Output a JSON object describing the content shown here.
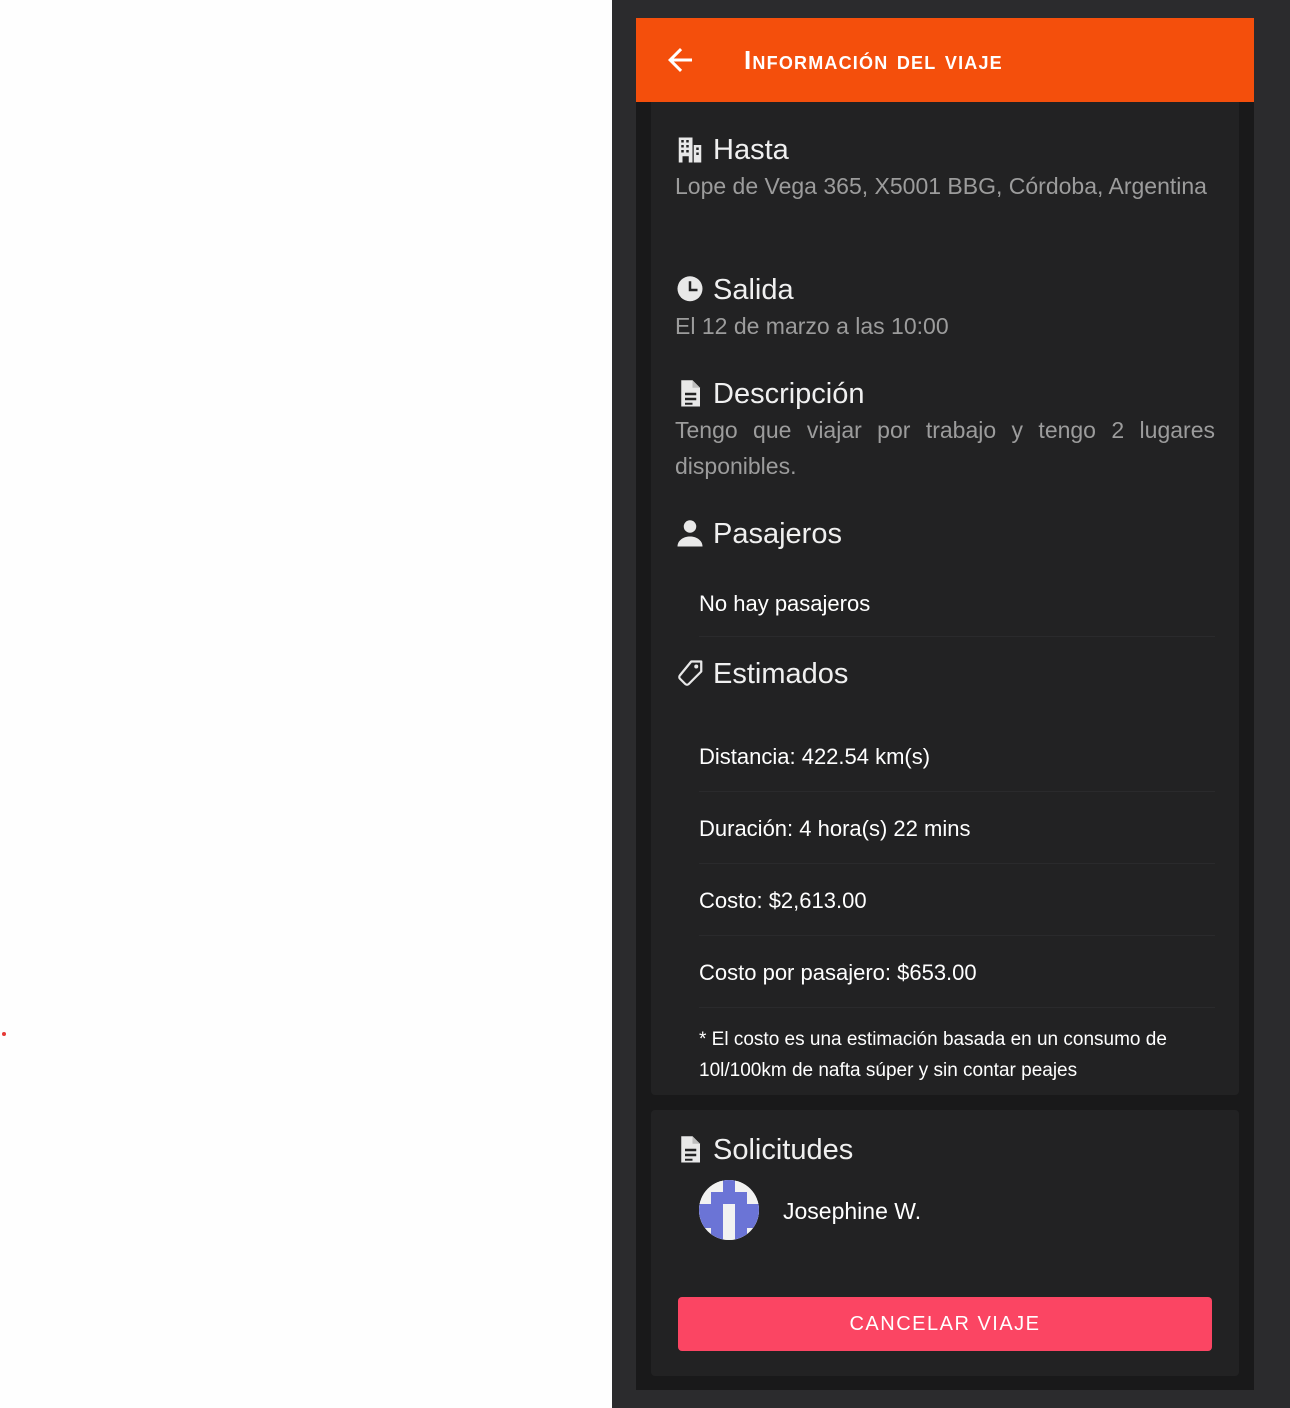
{
  "toolbar": {
    "title": "Información del viaje",
    "back_icon": "arrow-left-icon",
    "background": "#f44f0c"
  },
  "sections": {
    "hasta": {
      "icon": "building-icon",
      "title": "Hasta",
      "value": "Lope de Vega 365, X5001 BBG, Córdoba, Argentina"
    },
    "salida": {
      "icon": "clock-icon",
      "title": "Salida",
      "value": "El 12 de marzo a las 10:00"
    },
    "descripcion": {
      "icon": "document-icon",
      "title": "Descripción",
      "value": "Tengo que viajar por trabajo y tengo 2 lugares disponibles."
    },
    "pasajeros": {
      "icon": "person-icon",
      "title": "Pasajeros",
      "empty_text": "No hay pasajeros"
    },
    "estimados": {
      "icon": "tag-icon",
      "title": "Estimados",
      "items": [
        "Distancia: 422.54 km(s)",
        "Duración: 4 hora(s) 22 mins",
        "Costo: $2,613.00",
        "Costo por pasajero: $653.00"
      ],
      "note": "* El costo es una estimación basada en un consumo de 10l/100km de nafta súper y sin contar peajes"
    }
  },
  "solicitudes": {
    "icon": "document-icon",
    "title": "Solicitudes",
    "requests": [
      {
        "name": "Josephine W.",
        "avatar": "identicon-avatar"
      }
    ],
    "cancel_label": "CANCELAR VIAJE",
    "cancel_color": "#fb4563"
  }
}
